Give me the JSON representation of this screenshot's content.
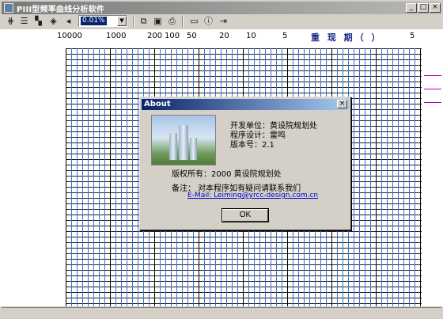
{
  "window": {
    "title": "PIII型频率曲线分析软件"
  },
  "toolbar": {
    "combo_value": "0.01%",
    "tools": [
      "grid-icon",
      "list-icon",
      "chart-icon",
      "settings-icon",
      "back-icon",
      "copy-icon",
      "save-icon",
      "print-icon",
      "window-icon",
      "info-icon",
      "exit-icon"
    ]
  },
  "scale": {
    "ticks": [
      "10000",
      "1000",
      "200",
      "100",
      "50",
      "20",
      "10",
      "5",
      "5"
    ],
    "return_period_label": "重 现 期（    ）"
  },
  "dialog": {
    "title": "About",
    "close": "×",
    "developer": "开发单位：黄设院规划处",
    "designer": "程序设计：雷鸣",
    "version": "版本号：2.1",
    "copyright": "版权所有：2000  黄设院规划处",
    "note": "备注：     对本程序如有疑问请联系我们",
    "email": "E-Mail: Leiming@yrcc-design.com.cn",
    "ok": "OK"
  },
  "colors": {
    "title_active": "#0a246a",
    "grid_minor": "#3a6fd0",
    "curve": "#b000b0"
  }
}
